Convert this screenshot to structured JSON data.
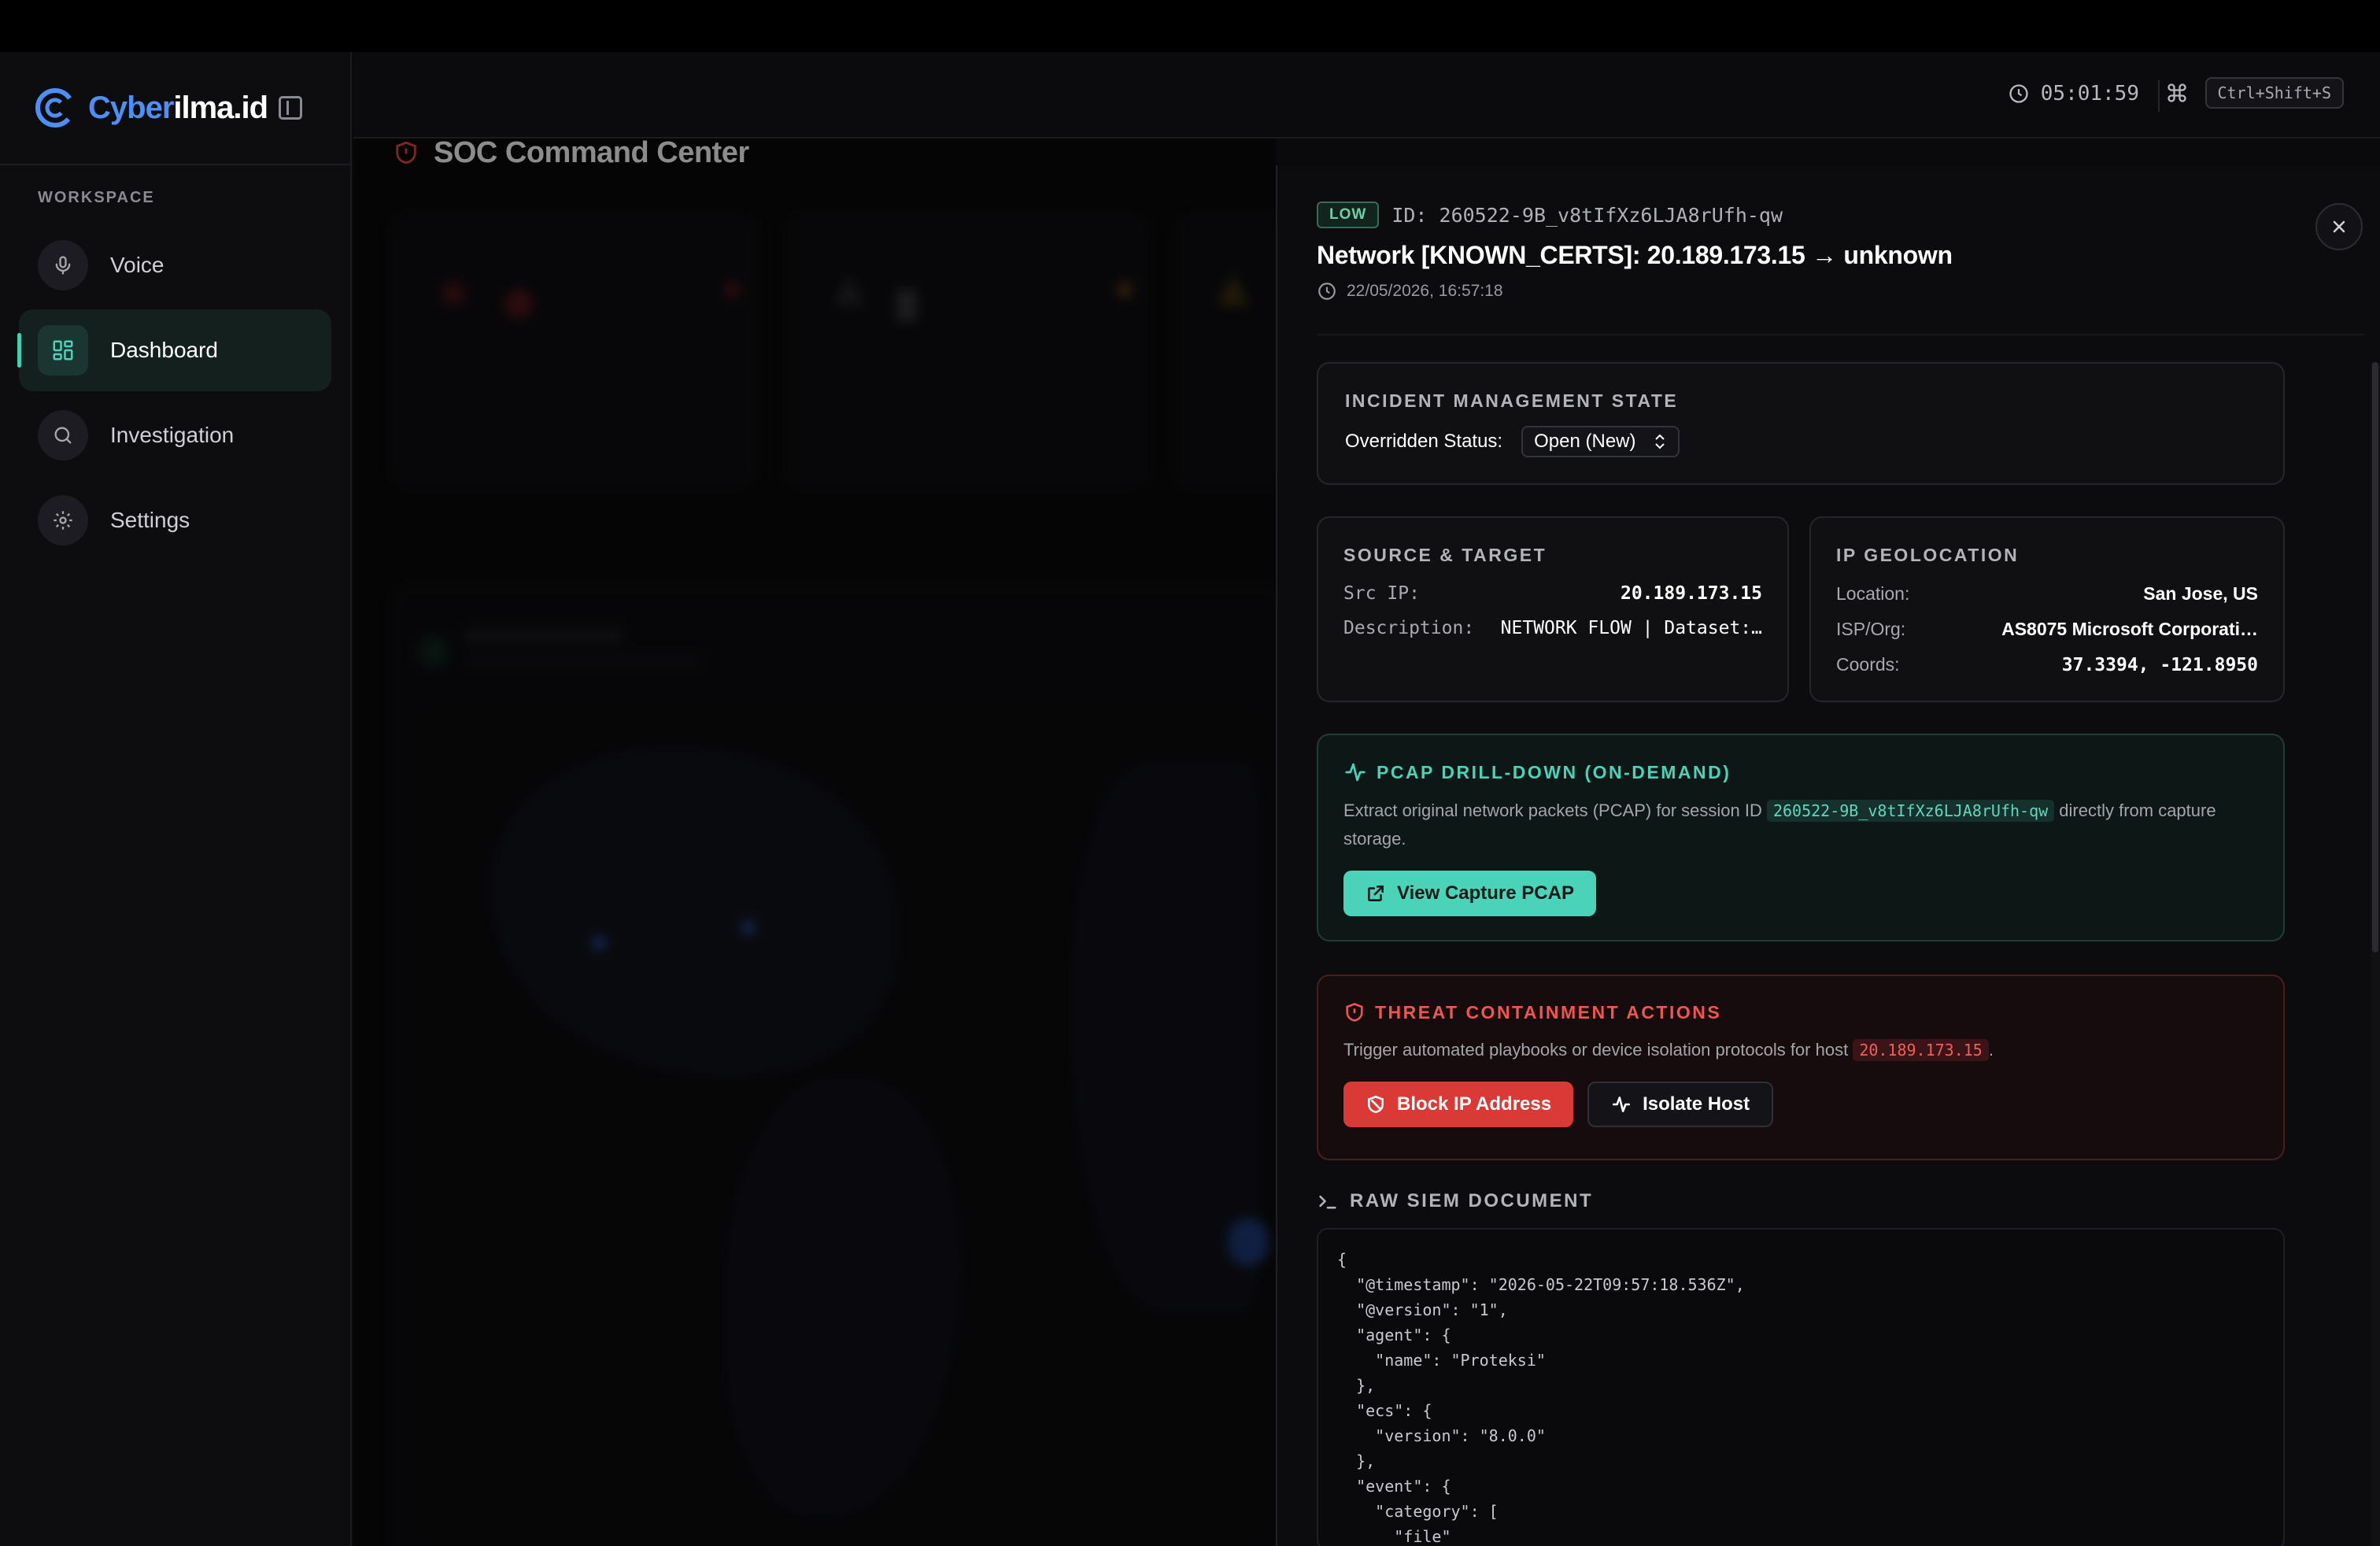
{
  "brand": {
    "name_a": "Cyber",
    "name_b": "ilma.id"
  },
  "sidebar": {
    "section_label": "WORKSPACE",
    "items": [
      {
        "label": "Voice",
        "icon": "mic-icon"
      },
      {
        "label": "Dashboard",
        "icon": "grid-icon",
        "active": true
      },
      {
        "label": "Investigation",
        "icon": "search-icon"
      },
      {
        "label": "Settings",
        "icon": "gear-icon"
      }
    ]
  },
  "header": {
    "clock": "05:01:59",
    "shortcut": "Ctrl+Shift+S"
  },
  "page": {
    "title": "SOC Command Center"
  },
  "incident": {
    "severity": "LOW",
    "id_label": "ID: 260522-9B_v8tIfXz6LJA8rUfh-qw",
    "title": "Network [KNOWN_CERTS]: 20.189.173.15 → unknown",
    "timestamp": "22/05/2026, 16:57:18"
  },
  "management": {
    "heading": "INCIDENT MANAGEMENT STATE",
    "status_label": "Overridden Status:",
    "status_value": "Open (New)"
  },
  "source_target": {
    "heading": "SOURCE & TARGET",
    "src_ip_label": "Src IP:",
    "src_ip_value": "20.189.173.15",
    "desc_label": "Description:",
    "desc_value": "NETWORK FLOW | Dataset:…"
  },
  "geo": {
    "heading": "IP GEOLOCATION",
    "location_label": "Location:",
    "location_value": "San Jose, US",
    "isp_label": "ISP/Org:",
    "isp_value": "AS8075 Microsoft Corporati…",
    "coords_label": "Coords:",
    "coords_value": "37.3394, -121.8950"
  },
  "pcap": {
    "heading": "PCAP DRILL-DOWN (ON-DEMAND)",
    "text_before": "Extract original network packets (PCAP) for session ID ",
    "session_id": "260522-9B_v8tIfXz6LJA8rUfh-qw",
    "text_after": " directly from capture storage.",
    "button_label": "View Capture PCAP"
  },
  "threat": {
    "heading": "THREAT CONTAINMENT ACTIONS",
    "text_before": "Trigger automated playbooks or device isolation protocols for host ",
    "host": "20.189.173.15",
    "text_after": ".",
    "block_label": "Block IP Address",
    "isolate_label": "Isolate Host"
  },
  "raw": {
    "heading": "RAW SIEM DOCUMENT",
    "code": "{\n  \"@timestamp\": \"2026-05-22T09:57:18.536Z\",\n  \"@version\": \"1\",\n  \"agent\": {\n    \"name\": \"Proteksi\"\n  },\n  \"ecs\": {\n    \"version\": \"8.0.0\"\n  },\n  \"event\": {\n    \"category\": [\n      \"file\""
  },
  "colors": {
    "accent_teal": "#4bd3ba",
    "accent_blue": "#4c8ff5",
    "danger_red": "#d93a35"
  }
}
